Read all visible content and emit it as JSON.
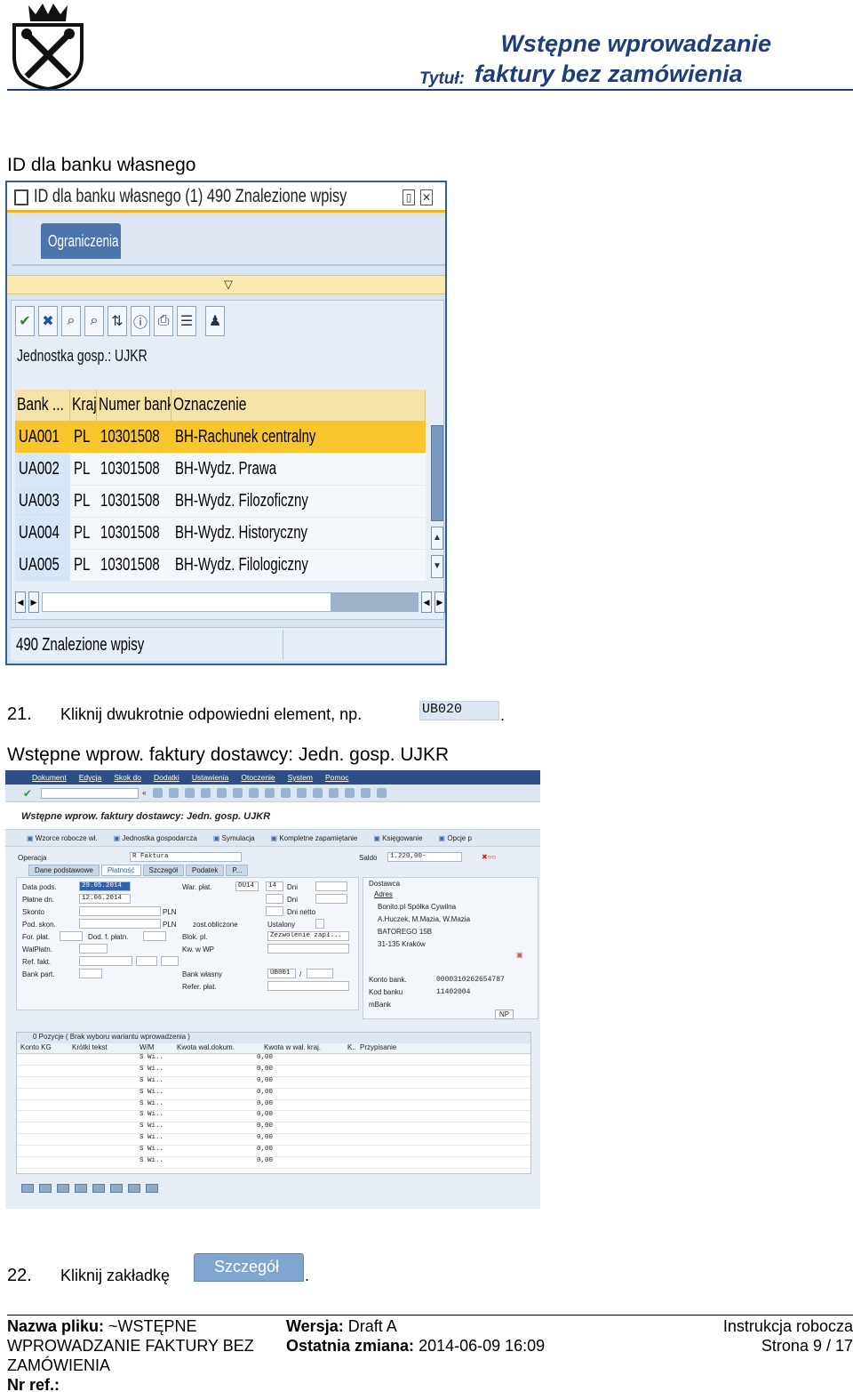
{
  "header": {
    "title_line1": "Wstępne wprowadzanie",
    "title_label": "Tytuł:",
    "title_line2": "faktury bez zamówienia"
  },
  "section1_heading": "ID dla banku własnego",
  "help_dialog": {
    "title": "ID dla banku własnego (1)  490 Znalezione wpisy",
    "tab": "Ograniczenia",
    "company_code": "Jednostka gosp.: UJKR",
    "columns": [
      "Bank ...",
      "Kraj",
      "Numer banku",
      "Oznaczenie"
    ],
    "rows": [
      [
        "UA001",
        "PL",
        "10301508",
        "BH-Rachunek centralny"
      ],
      [
        "UA002",
        "PL",
        "10301508",
        "BH-Wydz. Prawa"
      ],
      [
        "UA003",
        "PL",
        "10301508",
        "BH-Wydz. Filozoficzny"
      ],
      [
        "UA004",
        "PL",
        "10301508",
        "BH-Wydz. Historyczny"
      ],
      [
        "UA005",
        "PL",
        "10301508",
        "BH-Wydz. Filologiczny"
      ]
    ],
    "selected_row": 0,
    "status": "490 Znalezione wpisy"
  },
  "step21": {
    "number": "21.",
    "text": "Kliknij dwukrotnie odpowiedni element, np.",
    "example": "UB020",
    "suffix": "."
  },
  "section2_heading": "Wstępne wprow. faktury dostawcy: Jedn. gosp. UJKR",
  "miro": {
    "menu": [
      "Dokument",
      "Edycja",
      "Skok do",
      "Dodatki",
      "Ustawienia",
      "Otoczenie",
      "System",
      "Pomoc"
    ],
    "title": "Wstępne wprow. faktury dostawcy: Jedn. gosp. UJKR",
    "app_buttons": [
      "Wzorce robocze wł.",
      "Jednostka gospodarcza",
      "Symulacja",
      "Kompletne zapamiętanie",
      "Księgowanie",
      "Opcje p"
    ],
    "operation_label": "Operacja",
    "operation_value": "R Faktura",
    "balance_label": "Saldo",
    "balance_value": "1.220,00-",
    "tabs": [
      "Dane podstawowe",
      "Płatność",
      "Szczegół",
      "Podatek",
      "P..."
    ],
    "active_tab": 1,
    "form": {
      "data_pods_label": "Data pods.",
      "data_pods": "29.05.2014",
      "platne_dn_label": "Płatne dn.",
      "platne_dn": "12.06.2014",
      "skonto_label": "Skonto",
      "skonto_cur": "PLN",
      "pod_skon_label": "Pod. skon.",
      "pod_skon_cur": "PLN",
      "zost_obl": "zost.obliczone",
      "for_plat_label": "For. płat.",
      "dod_f_platn_label": "Dod. f. płatn.",
      "walplatn_label": "WalPłatn.",
      "ref_fakt_label": "Ref. fakt.",
      "bank_part_label": "Bank part.",
      "war_plat_label": "War. płat.",
      "war_plat_value": "DU14",
      "days1": "14",
      "dni1": "Dni",
      "dni2": "Dni",
      "dni_netto": "Dni netto",
      "ustalony": "Ustalony",
      "blok_pl_label": "Blok. pl.",
      "blok_value": "Zezwolenie zapł...",
      "kw_w_wp_label": "Kw. w WP",
      "bank_wlasny_label": "Bank własny",
      "bank_wlasny_value": "UB001",
      "bank_slash": "/",
      "refer_plat_label": "Refer. płat."
    },
    "vendor": {
      "header": "Dostawca",
      "adres": "Adres",
      "lines": [
        "Bonito.pl Spółka Cywilna",
        "A.Huczek, M.Mazia, W.Mazia",
        "BATOREGO 15B",
        "31-135 Kraków"
      ],
      "konto_label": "Konto bank.",
      "konto_value": "0000310262654787",
      "kod_label": "Kod banku",
      "kod_value": "11402004",
      "bank_name": "mBank",
      "np": "NP"
    },
    "grid": {
      "header": "0 Pozycje ( Brak wyboru wariantu wprowadzenia )",
      "columns": [
        "Konto KG",
        "Krótki tekst",
        "W/M",
        "Kwota wal.dokum.",
        "Kwota w wal. kraj.",
        "K..",
        "Przypisanie"
      ],
      "rows": [
        [
          "S Wi..",
          "0,00"
        ],
        [
          "S Wi..",
          "0,00"
        ],
        [
          "S Wi..",
          "0,00"
        ],
        [
          "S Wi..",
          "0,00"
        ],
        [
          "S Wi..",
          "0,00"
        ],
        [
          "S Wi..",
          "0,00"
        ],
        [
          "S Wi..",
          "0,00"
        ],
        [
          "S Wi..",
          "0,00"
        ],
        [
          "S Wi..",
          "0,00"
        ],
        [
          "S Wi..",
          "0,00"
        ]
      ]
    }
  },
  "step22": {
    "number": "22.",
    "text": "Kliknij zakładkę",
    "tab_label": "Szczegół",
    "suffix": "."
  },
  "footer": {
    "filename_label": "Nazwa pliku:",
    "filename_line1": "~WSTĘPNE",
    "filename_line2": "WPROWADZANIE FAKTURY BEZ",
    "filename_line3": "ZAMÓWIENIA",
    "ref_label": "Nr ref.:",
    "version_label": "Wersja:",
    "version_value": "Draft A",
    "change_label": "Ostatnia zmiana:",
    "change_value": "2014-06-09 16:09",
    "doc_type": "Instrukcja robocza",
    "page": "Strona 9 / 17"
  }
}
